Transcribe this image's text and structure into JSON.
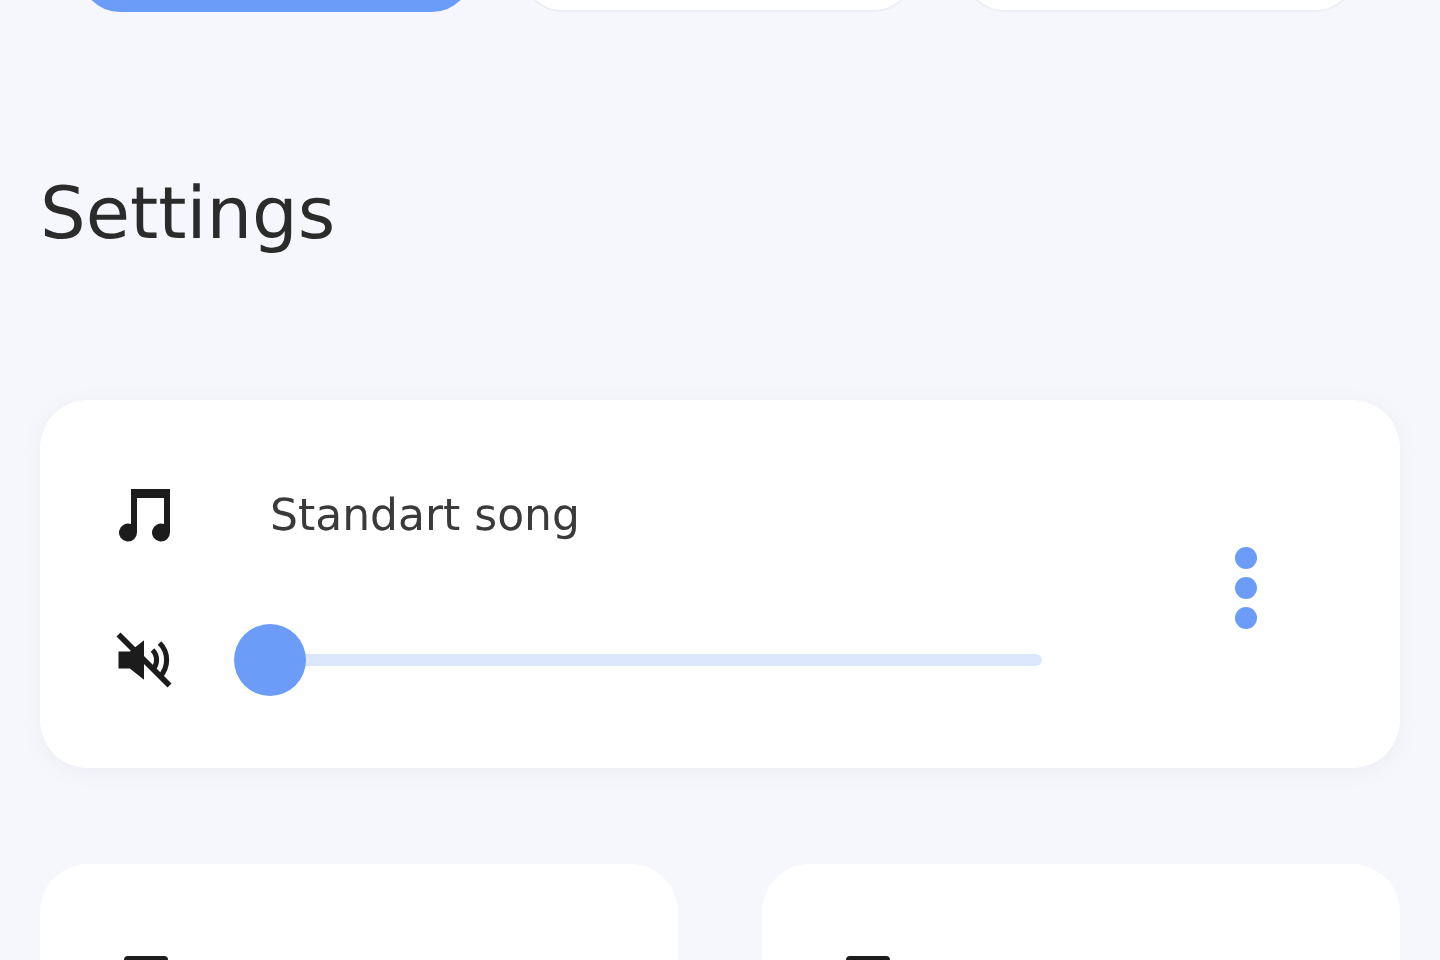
{
  "tabs": [
    {
      "selected": true
    },
    {
      "selected": false
    },
    {
      "selected": false
    }
  ],
  "heading": "Settings",
  "sound_card": {
    "title": "Standart song",
    "muted": true,
    "volume": {
      "level": 0
    }
  },
  "bottom_cards": [
    {
      "kind": "tile"
    },
    {
      "kind": "tile"
    }
  ]
}
